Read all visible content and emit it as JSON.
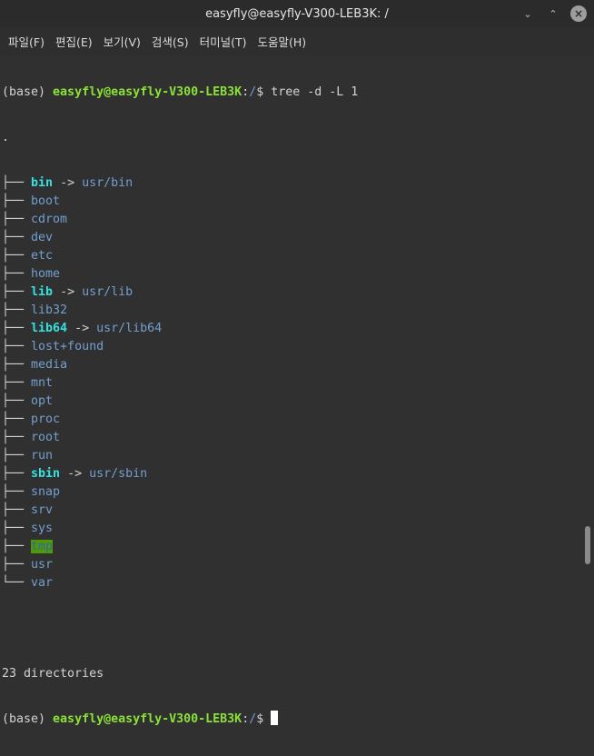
{
  "window": {
    "title": "easyfly@easyfly-V300-LEB3K: /"
  },
  "menu": {
    "items": [
      "파일(F)",
      "편집(E)",
      "보기(V)",
      "검색(S)",
      "터미널(T)",
      "도움말(H)"
    ]
  },
  "terminal": {
    "prompt_prefix": "(base) ",
    "user_host": "easyfly@easyfly-V300-LEB3K",
    "colon": ":",
    "cwd": "/",
    "dollar": "$ ",
    "command": "tree -d -L 1",
    "root": ".",
    "branch": "├── ",
    "last_branch": "└── ",
    "arrow": " -> ",
    "entries": [
      {
        "name": "bin",
        "target": "usr/bin"
      },
      {
        "name": "boot"
      },
      {
        "name": "cdrom"
      },
      {
        "name": "dev"
      },
      {
        "name": "etc"
      },
      {
        "name": "home"
      },
      {
        "name": "lib",
        "target": "usr/lib"
      },
      {
        "name": "lib32"
      },
      {
        "name": "lib64",
        "target": "usr/lib64"
      },
      {
        "name": "lost+found"
      },
      {
        "name": "media"
      },
      {
        "name": "mnt"
      },
      {
        "name": "opt"
      },
      {
        "name": "proc"
      },
      {
        "name": "root"
      },
      {
        "name": "run"
      },
      {
        "name": "sbin",
        "target": "usr/sbin"
      },
      {
        "name": "snap"
      },
      {
        "name": "srv"
      },
      {
        "name": "sys"
      },
      {
        "name": "tmp"
      },
      {
        "name": "usr"
      },
      {
        "name": "var"
      }
    ],
    "summary": "23 directories"
  }
}
